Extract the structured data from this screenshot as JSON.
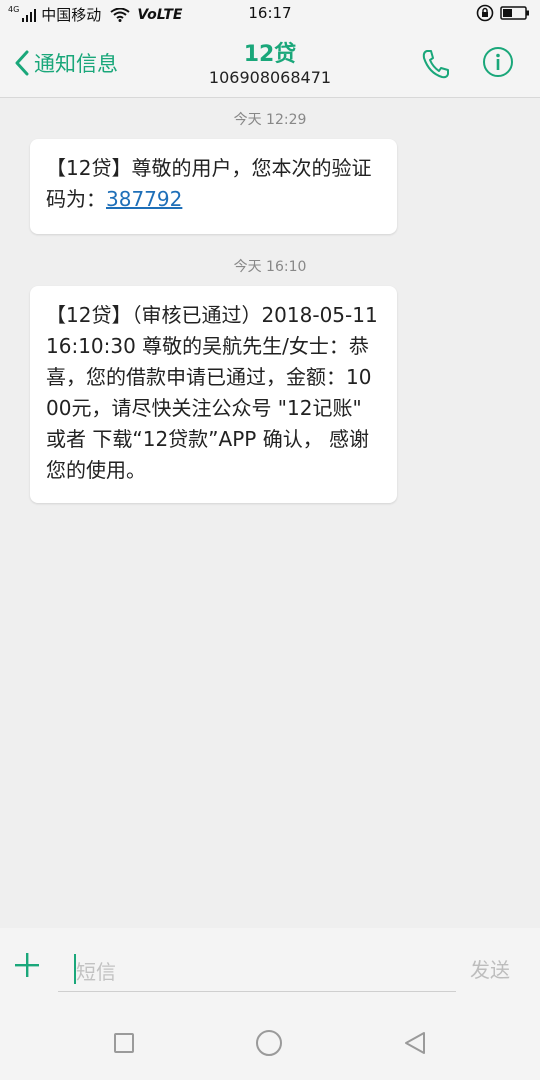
{
  "status_bar": {
    "network_tag": "4G",
    "carrier": "中国移动",
    "volte": "VoLTE",
    "time": "16:17",
    "icons": [
      "signal-icon",
      "wifi-icon",
      "rotation-lock-icon",
      "battery-icon"
    ]
  },
  "header": {
    "back_label": "通知信息",
    "title": "12贷",
    "sender_number": "106908068471",
    "icons": [
      "back-chevron-icon",
      "phone-icon",
      "info-icon"
    ],
    "accent_color": "#1aa77a"
  },
  "messages": [
    {
      "time": "今天 12:29",
      "text_before": "【12贷】尊敬的用户，您本次的验证码为：",
      "code": "387792"
    },
    {
      "time": "今天 16:10",
      "text": "【12贷】（审核已通过）2018-05-11 16:10:30 尊敬的吴航先生/女士：恭喜，您的借款申请已通过，金额：1000元，请尽快关注公众号 \"12记账\" 或者 下载“12贷款”APP 确认， 感谢您的使用。"
    }
  ],
  "composer": {
    "placeholder": "短信",
    "send_label": "发送",
    "icons": [
      "plus-icon"
    ]
  },
  "nav_bar": {
    "icons": [
      "recents-square-icon",
      "home-circle-icon",
      "back-triangle-icon"
    ]
  }
}
